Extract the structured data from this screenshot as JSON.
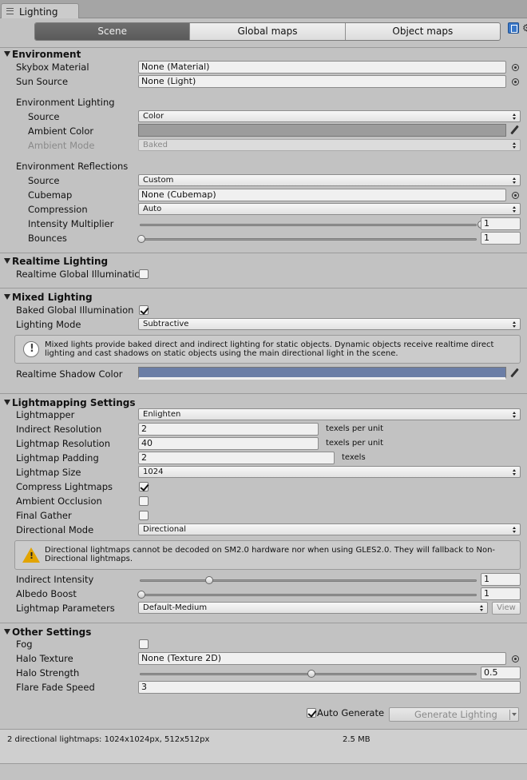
{
  "window": {
    "tab_title": "Lighting"
  },
  "tabs": [
    "Scene",
    "Global maps",
    "Object maps"
  ],
  "environment": {
    "header": "Environment",
    "skybox_label": "Skybox Material",
    "skybox_value": "None (Material)",
    "sun_label": "Sun Source",
    "sun_value": "None (Light)",
    "lighting_heading": "Environment Lighting",
    "source_label": "Source",
    "source_value": "Color",
    "ambient_color_label": "Ambient Color",
    "ambient_color": "#9c9c9c",
    "ambient_mode_label": "Ambient Mode",
    "ambient_mode_value": "Baked",
    "reflections_heading": "Environment Reflections",
    "refl_source_label": "Source",
    "refl_source_value": "Custom",
    "cubemap_label": "Cubemap",
    "cubemap_value": "None (Cubemap)",
    "compression_label": "Compression",
    "compression_value": "Auto",
    "intensity_label": "Intensity Multiplier",
    "intensity_value": "1",
    "intensity_level": 1.0,
    "bounces_label": "Bounces",
    "bounces_value": "1",
    "bounces_level": 0.0
  },
  "realtime": {
    "header": "Realtime Lighting",
    "gi_label": "Realtime Global Illuminatic",
    "gi_checked": false
  },
  "mixed": {
    "header": "Mixed Lighting",
    "baked_gi_label": "Baked Global Illumination",
    "baked_gi_checked": true,
    "mode_label": "Lighting Mode",
    "mode_value": "Subtractive",
    "note": "Mixed lights provide baked direct and indirect lighting for static objects. Dynamic objects receive realtime direct lighting and cast shadows on static objects using the main directional light in the scene.",
    "shadow_color_label": "Realtime Shadow Color",
    "shadow_color": "#6b7ea6"
  },
  "lightmapping": {
    "header": "Lightmapping Settings",
    "lightmapper_label": "Lightmapper",
    "lightmapper_value": "Enlighten",
    "indirect_res_label": "Indirect Resolution",
    "indirect_res_value": "2",
    "indirect_res_unit": "texels per unit",
    "lightmap_res_label": "Lightmap Resolution",
    "lightmap_res_value": "40",
    "lightmap_res_unit": "texels per unit",
    "padding_label": "Lightmap Padding",
    "padding_value": "2",
    "padding_unit": "texels",
    "size_label": "Lightmap Size",
    "size_value": "1024",
    "compress_label": "Compress Lightmaps",
    "compress_checked": true,
    "ao_label": "Ambient Occlusion",
    "ao_checked": false,
    "final_gather_label": "Final Gather",
    "final_gather_checked": false,
    "directional_label": "Directional Mode",
    "directional_value": "Directional",
    "warning": "Directional lightmaps cannot be decoded on SM2.0 hardware nor when using GLES2.0. They will fallback to Non-Directional lightmaps.",
    "indirect_intensity_label": "Indirect Intensity",
    "indirect_intensity_value": "1",
    "indirect_intensity_level": 0.2,
    "albedo_label": "Albedo Boost",
    "albedo_value": "1",
    "albedo_level": 0.0,
    "params_label": "Lightmap Parameters",
    "params_value": "Default-Medium",
    "view_label": "View"
  },
  "other": {
    "header": "Other Settings",
    "fog_label": "Fog",
    "fog_checked": false,
    "halo_texture_label": "Halo Texture",
    "halo_texture_value": "None (Texture 2D)",
    "halo_strength_label": "Halo Strength",
    "halo_strength_value": "0.5",
    "halo_strength_level": 0.5,
    "flare_label": "Flare Fade Speed",
    "flare_value": "3"
  },
  "footer": {
    "auto_generate_label": "Auto Generate",
    "auto_generate_checked": true,
    "generate_label": "Generate Lighting",
    "status_maps": "2 directional lightmaps: 1024x1024px, 512x512px",
    "status_size": "2.5 MB"
  }
}
